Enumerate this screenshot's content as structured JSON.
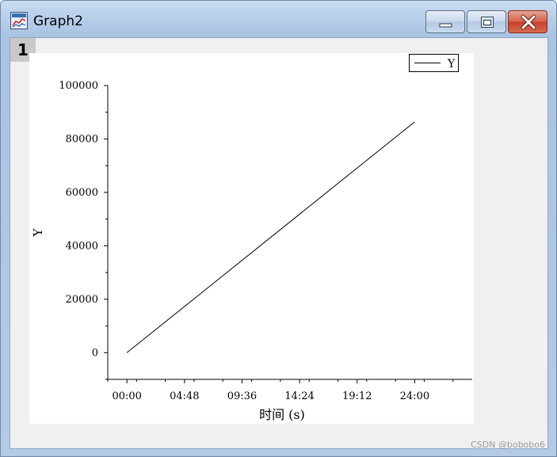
{
  "window": {
    "title": "Graph2",
    "layer_number": "1",
    "watermark": "CSDN @bobobo6",
    "buttons": {
      "minimize": "minimize",
      "maximize": "maximize",
      "close": "close"
    }
  },
  "colors": {
    "line": "#000000",
    "titlebar": "#b9d0ea",
    "close_button": "#c54229"
  },
  "chart_data": {
    "type": "line",
    "xlabel": "时间 (s)",
    "ylabel": "Y",
    "x_tick_labels": [
      "00:00",
      "04:48",
      "09:36",
      "14:24",
      "19:12",
      "24:00"
    ],
    "x_ticks_hours": [
      0,
      4.8,
      9.6,
      14.4,
      19.2,
      24
    ],
    "xlim_hours": [
      -1.6,
      28.8
    ],
    "y_ticks": [
      0,
      20000,
      40000,
      60000,
      80000,
      100000
    ],
    "y_tick_labels": [
      "0",
      "20000",
      "40000",
      "60000",
      "80000",
      "100000"
    ],
    "ylim": [
      -10000,
      100000
    ],
    "grid": false,
    "legend": {
      "position": "top-right",
      "entries": [
        "Y"
      ]
    },
    "series": [
      {
        "name": "Y",
        "x_hours": [
          0,
          24
        ],
        "values": [
          0,
          86400
        ]
      }
    ]
  }
}
